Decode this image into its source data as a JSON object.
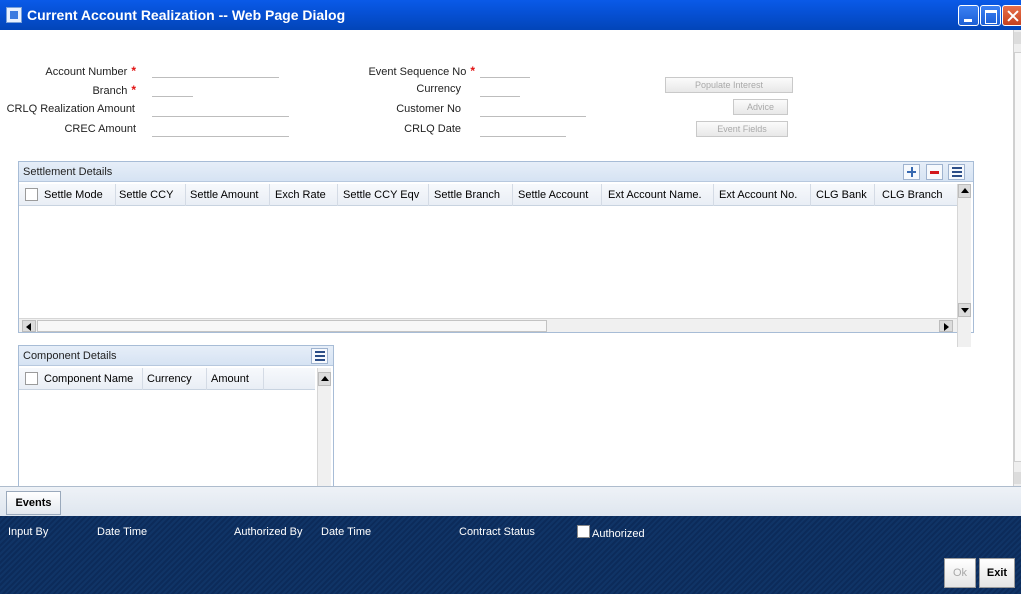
{
  "window": {
    "title": "Current Account Realization -- Web Page Dialog"
  },
  "form": {
    "account_number_label": "Account Number",
    "branch_label": "Branch",
    "crlq_realization_amount_label": "CRLQ Realization Amount",
    "crec_amount_label": "CREC Amount",
    "event_sequence_no_label": "Event Sequence No",
    "currency_label": "Currency",
    "customer_no_label": "Customer No",
    "crlq_date_label": "CRLQ Date",
    "required_marker": "*",
    "account_number_value": "",
    "branch_value": "",
    "crlq_realization_amount_value": "",
    "crec_amount_value": "",
    "event_sequence_no_value": "",
    "currency_value": "",
    "customer_no_value": "",
    "crlq_date_value": ""
  },
  "buttons": {
    "populate_interest": "Populate Interest",
    "advice": "Advice",
    "event_fields": "Event Fields"
  },
  "settlement": {
    "title": "Settlement Details",
    "columns": [
      "Settle Mode",
      "Settle CCY",
      "Settle Amount",
      "Exch Rate",
      "Settle CCY Eqv",
      "Settle Branch",
      "Settle Account",
      "Ext Account Name.",
      "Ext Account No.",
      "CLG Bank",
      "CLG Branch"
    ],
    "rows": []
  },
  "component": {
    "title": "Component Details",
    "columns": [
      "Component Name",
      "Currency",
      "Amount"
    ],
    "rows": []
  },
  "events": {
    "label": "Events"
  },
  "footer": {
    "input_by": "Input By",
    "date_time_1": "Date Time",
    "authorized_by": "Authorized By",
    "date_time_2": "Date Time",
    "contract_status": "Contract Status",
    "authorized": "Authorized",
    "ok": "Ok",
    "exit": "Exit"
  },
  "colors": {
    "title_bar": "#0651d6",
    "required": "#e21313",
    "footer_bg": "#0c2b5a",
    "panel_border": "#a7bcd6"
  }
}
